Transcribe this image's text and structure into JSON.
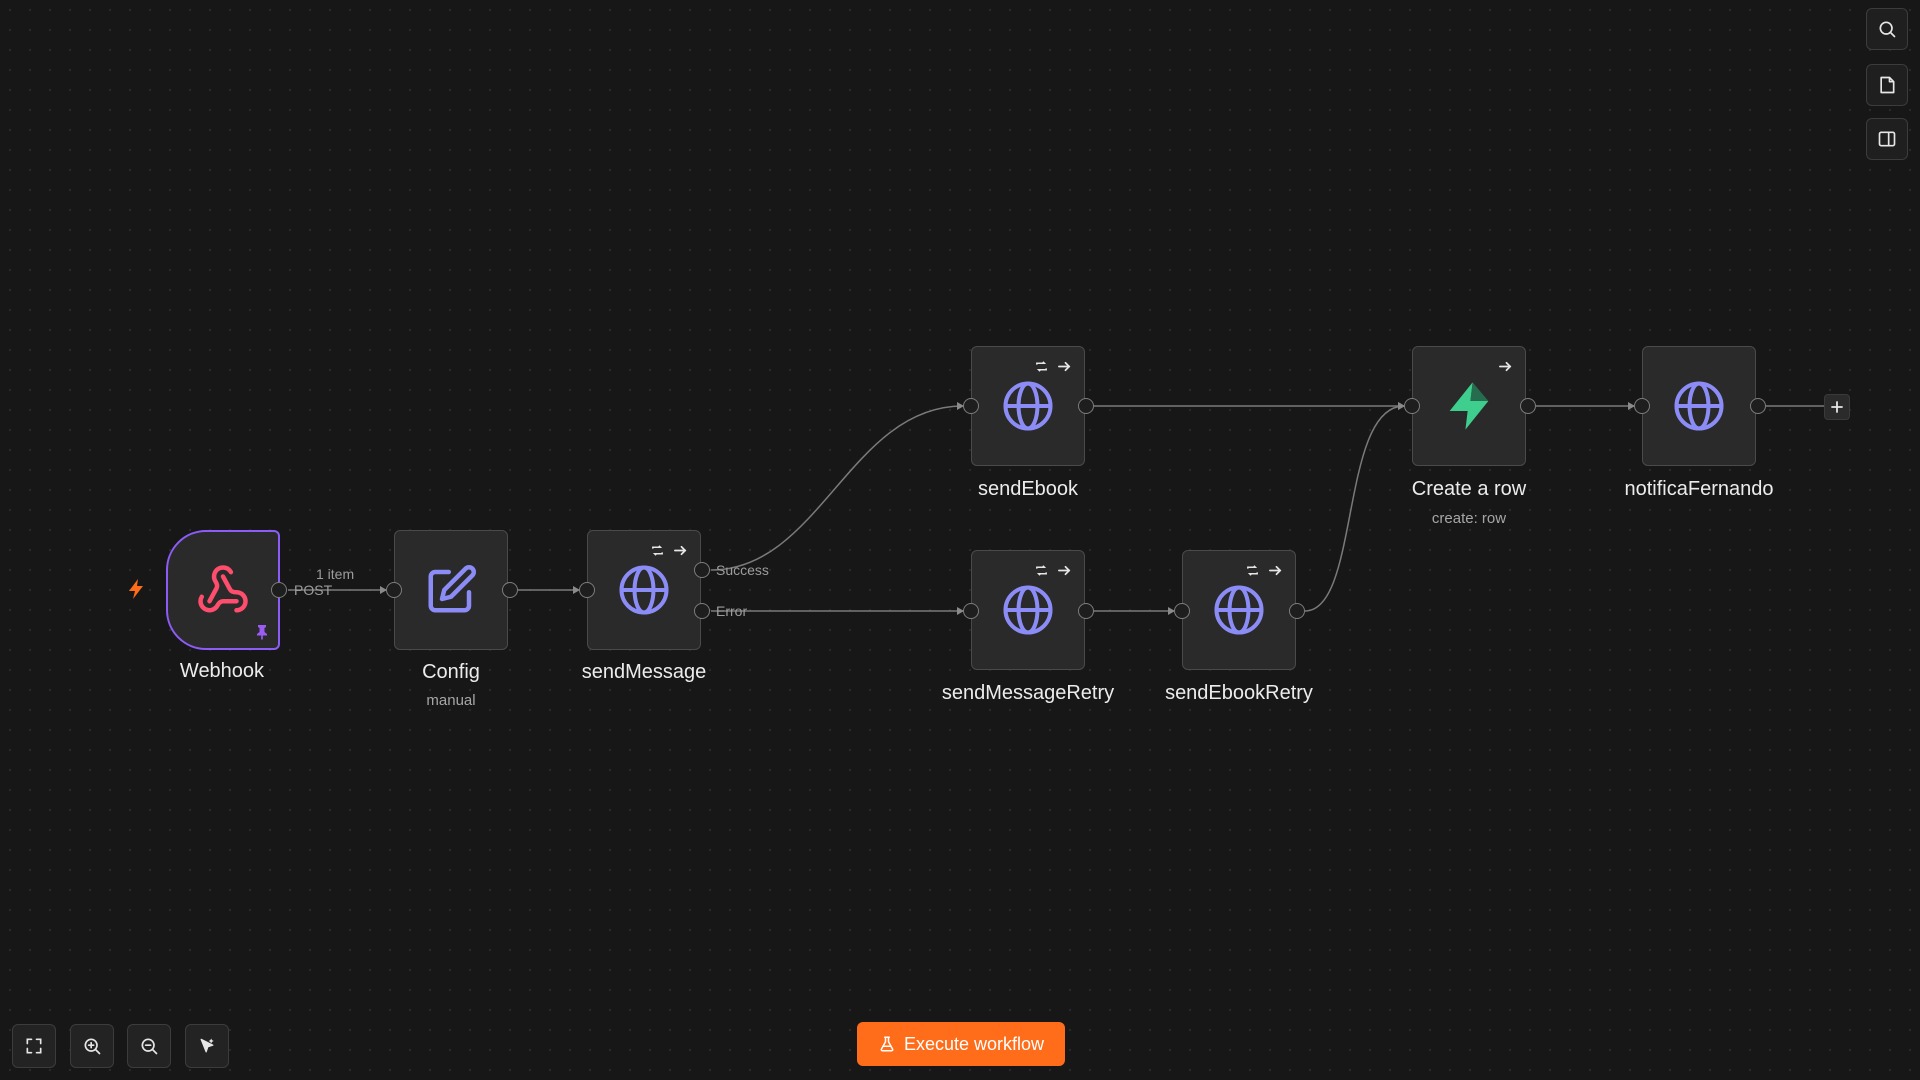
{
  "nodes": {
    "webhook": {
      "label": "Webhook",
      "icon": "webhook-icon",
      "color": "#ff4d6d"
    },
    "config": {
      "label": "Config",
      "subtitle": "manual",
      "icon": "edit-icon"
    },
    "send_message": {
      "label": "sendMessage",
      "icon": "globe-icon"
    },
    "send_ebook": {
      "label": "sendEbook",
      "icon": "globe-icon"
    },
    "send_message_retry": {
      "label": "sendMessageRetry",
      "icon": "globe-icon"
    },
    "send_ebook_retry": {
      "label": "sendEbookRetry",
      "icon": "globe-icon"
    },
    "create_row": {
      "label": "Create a row",
      "subtitle": "create: row",
      "icon": "supabase-icon",
      "color": "#3ecf8e"
    },
    "notifica_fernando": {
      "label": "notificaFernando",
      "icon": "globe-icon"
    }
  },
  "edges": {
    "webhook_config": {
      "top_label": "1 item",
      "output_label": "POST"
    },
    "send_message_success": "Success",
    "send_message_error": "Error"
  },
  "toolbar": {
    "execute_label": "Execute workflow"
  },
  "colors": {
    "accent": "#ff6d1a",
    "trigger_border": "#8b5cf6",
    "http_icon": "#8b8cf6",
    "canvas": "#171717"
  },
  "side_buttons": [
    "search-icon",
    "sticky-note-icon",
    "panel-toggle-icon"
  ],
  "canvas_controls": [
    "fit-view-icon",
    "zoom-in-icon",
    "zoom-out-icon",
    "tidy-up-icon"
  ]
}
